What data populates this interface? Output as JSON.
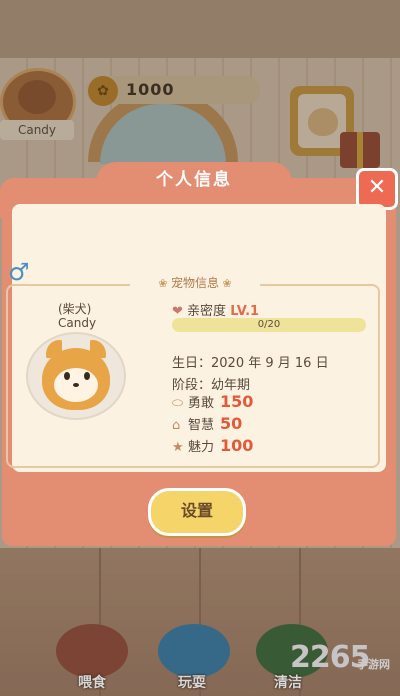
{
  "hud": {
    "username": "Candy",
    "coins": "1000"
  },
  "dialog": {
    "title": "个人信息",
    "close_label": "✕",
    "gender_symbol": "♂",
    "section_title": "宠物信息",
    "pet": {
      "breed": "(柴犬)",
      "name": "Candy"
    },
    "intimacy": {
      "label": "亲密度",
      "level": "LV.1",
      "progress_text": "0/20",
      "progress": 0
    },
    "birthday": {
      "label": "生日：",
      "value": "2020 年 9 月 16 日"
    },
    "stage": {
      "label": "阶段：",
      "value": "幼年期"
    },
    "stats": [
      {
        "label": "勇敢",
        "value": "150",
        "icon": "shield-icon"
      },
      {
        "label": "智慧",
        "value": "50",
        "icon": "cap-icon"
      },
      {
        "label": "魅力",
        "value": "100",
        "icon": "star-icon"
      }
    ],
    "settings_label": "设置"
  },
  "actions": [
    {
      "label": "喂食",
      "icon": "food-bowl-icon"
    },
    {
      "label": "玩耍",
      "icon": "frisbee-icon"
    },
    {
      "label": "清洁",
      "icon": "brush-icon"
    }
  ],
  "watermark": {
    "big": "2265",
    "small": "手游网"
  },
  "colors": {
    "dialog": "#e38d72",
    "panel": "#fbf2e1",
    "accent": "#e35a3a",
    "button": "#f5d56a"
  }
}
